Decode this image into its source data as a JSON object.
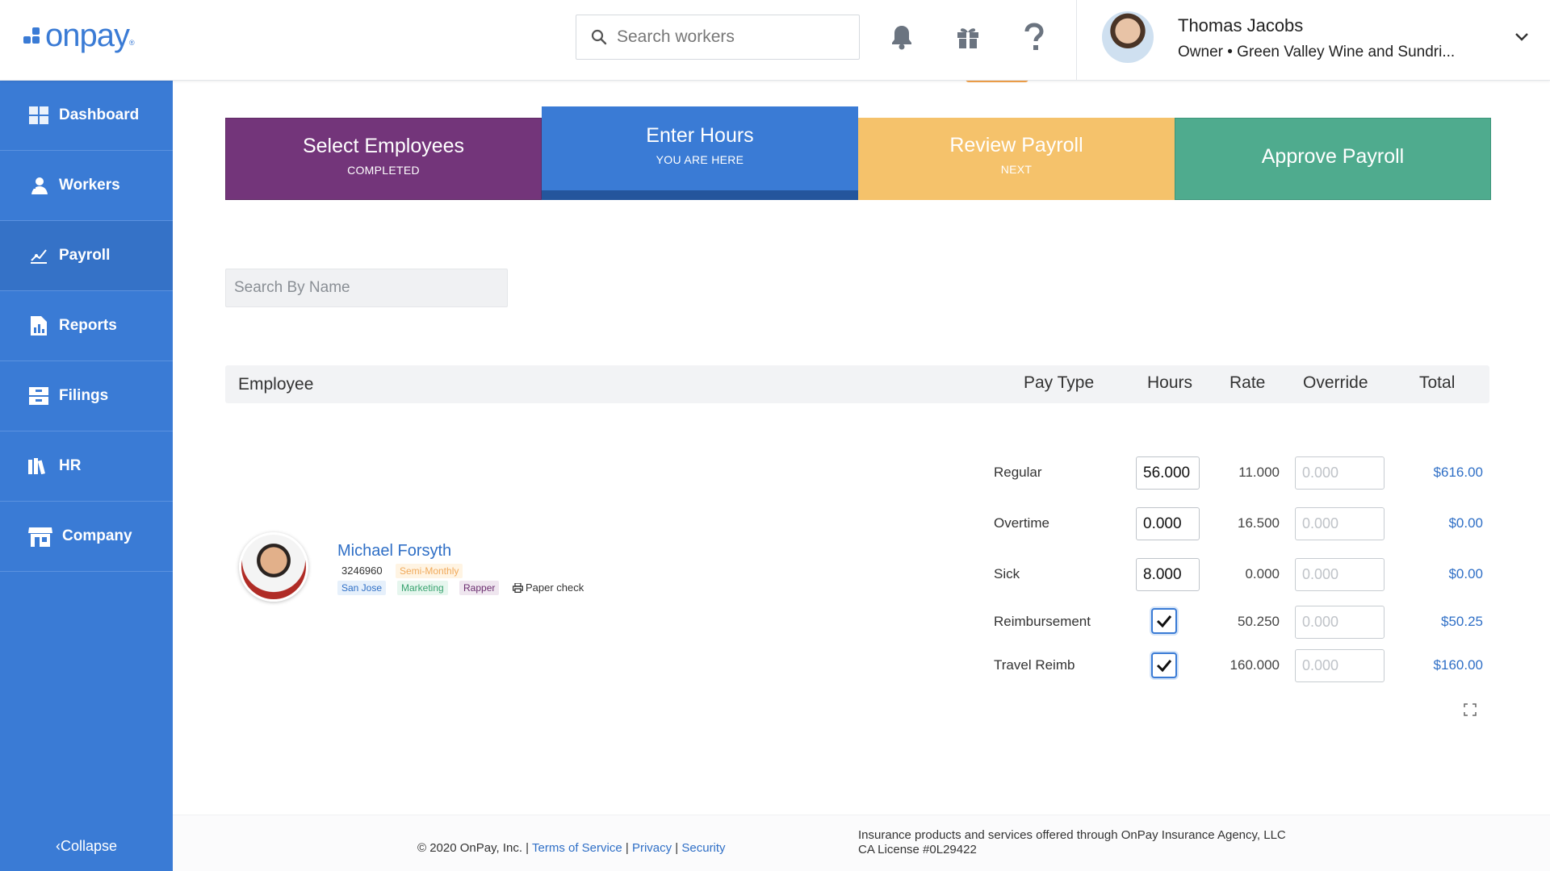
{
  "brand": {
    "logo_text": "onpay",
    "reg_mark": "®"
  },
  "header": {
    "search_placeholder": "Search workers",
    "user_name": "Thomas Jacobs",
    "user_subtitle": "Owner • Green Valley Wine and Sundri..."
  },
  "sidebar": {
    "items": [
      {
        "label": "Dashboard",
        "icon": "dashboard-grid-icon"
      },
      {
        "label": "Workers",
        "icon": "workers-icon"
      },
      {
        "label": "Payroll",
        "icon": "payroll-icon"
      },
      {
        "label": "Reports",
        "icon": "reports-icon"
      },
      {
        "label": "Filings",
        "icon": "filings-icon"
      },
      {
        "label": "HR",
        "icon": "hr-books-icon"
      },
      {
        "label": "Company",
        "icon": "company-store-icon"
      }
    ],
    "active": "Payroll",
    "collapse_label": "Collapse"
  },
  "steps": [
    {
      "title": "Select Employees",
      "sub": "COMPLETED",
      "color": "#73357a"
    },
    {
      "title": "Enter Hours",
      "sub": "YOU ARE HERE",
      "color": "#3a7bd5"
    },
    {
      "title": "Review Payroll",
      "sub": "NEXT",
      "color": "#f5c26b"
    },
    {
      "title": "Approve Payroll",
      "sub": "",
      "color": "#4fab8e"
    }
  ],
  "name_search_placeholder": "Search By Name",
  "table": {
    "headers": {
      "employee": "Employee",
      "pay_type": "Pay Type",
      "hours": "Hours",
      "rate": "Rate",
      "override": "Override",
      "total": "Total"
    }
  },
  "employee": {
    "name": "Michael Forsyth",
    "id": "3246960",
    "frequency": "Semi-Monthly",
    "location": "San Jose",
    "department": "Marketing",
    "role": "Rapper",
    "payment_method": "Paper check"
  },
  "pay_rows": [
    {
      "type": "Regular",
      "hours": "56.000",
      "rate": "11.000",
      "override_placeholder": "0.000",
      "total": "$616.00"
    },
    {
      "type": "Overtime",
      "hours": "0.000",
      "rate": "16.500",
      "override_placeholder": "0.000",
      "total": "$0.00"
    },
    {
      "type": "Sick",
      "hours": "8.000",
      "rate": "0.000",
      "override_placeholder": "0.000",
      "total": "$0.00"
    },
    {
      "type": "Reimbursement",
      "checked": true,
      "rate": "50.250",
      "override_placeholder": "0.000",
      "total": "$50.25"
    },
    {
      "type": "Travel Reimb",
      "checked": true,
      "rate": "160.000",
      "override_placeholder": "0.000",
      "total": "$160.00"
    }
  ],
  "footer": {
    "copyright": "© 2020 OnPay, Inc. |",
    "terms": "Terms of Service",
    "sep1": "|",
    "privacy": "Privacy",
    "sep2": "|",
    "security": "Security",
    "insurance_line1": "Insurance products and services offered through OnPay Insurance Agency, LLC",
    "insurance_line2": "CA License #0L29422"
  },
  "colors": {
    "primary": "#3a7bd5",
    "link": "#2f6fc6"
  }
}
